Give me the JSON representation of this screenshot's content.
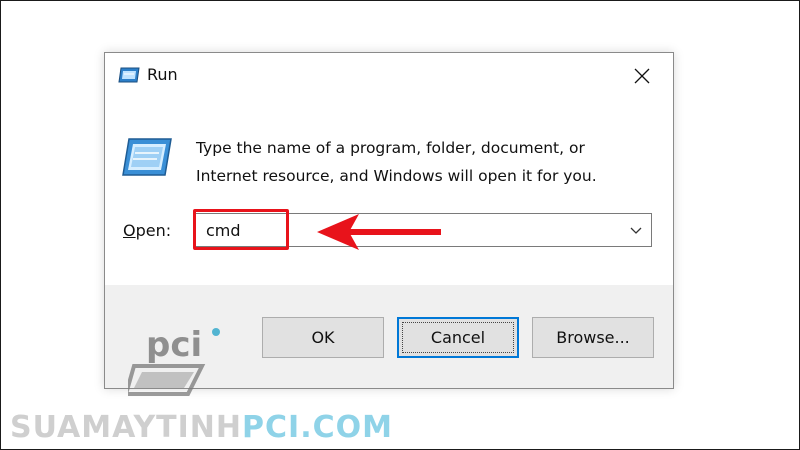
{
  "dialog": {
    "title": "Run",
    "description_line1": "Type the name of a program, folder, document, or",
    "description_line2": "Internet resource, and Windows will open it for you.",
    "open_label_hotkey": "O",
    "open_label_rest": "pen:",
    "open_value": "cmd",
    "buttons": {
      "ok": "OK",
      "cancel": "Cancel",
      "browse": "Browse..."
    }
  },
  "annotation": {
    "highlight_color": "#e8131b"
  },
  "watermark": {
    "text_part1": "SUAMAYTINH",
    "text_part2": "PCI.COM",
    "logo_text": "pci"
  },
  "colors": {
    "accent_button_border": "#0078d7",
    "dialog_footer": "#f0f0f0",
    "annotation_red": "#e8131b"
  },
  "icons": [
    "run-app-icon",
    "close-icon",
    "run-content-icon",
    "chevron-down-icon",
    "arrow-left-annotation-icon"
  ]
}
